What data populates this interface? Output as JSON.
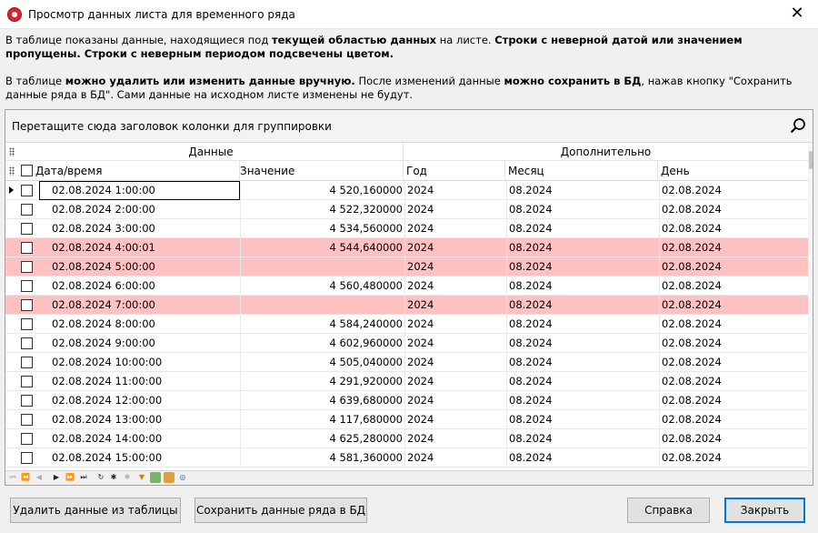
{
  "window": {
    "title": "Просмотр данных листа для временного ряда"
  },
  "info1": {
    "p1": "В таблице показаны данные, находящиеся под ",
    "b1": "текущей областью данных",
    "p2": " на листе.  ",
    "b2": "Строки с неверной датой или значением пропущены. Строки с неверным периодом подсвечены цветом."
  },
  "info2": {
    "p1": "В таблице ",
    "b1": "можно удалить или изменить данные вручную.",
    "p2": " После изменений данные ",
    "b2": "можно сохранить в БД",
    "p3": ", нажав кнопку \"Сохранить данные ряда в БД\". Сами данные на исходном листе изменены не будут."
  },
  "grid": {
    "group_panel_text": "Перетащите сюда заголовок колонки для группировки",
    "bands": {
      "data": "Данные",
      "extra": "Дополнительно"
    },
    "columns": {
      "datetime": "Дата/время",
      "value": "Значение",
      "year": "Год",
      "month": "Месяц",
      "day": "День"
    },
    "rows": [
      {
        "datetime": "02.08.2024 1:00:00",
        "value": "4 520,160000",
        "year": "2024",
        "month": "08.2024",
        "day": "02.08.2024",
        "highlight": false,
        "current": true
      },
      {
        "datetime": "02.08.2024 2:00:00",
        "value": "4 522,320000",
        "year": "2024",
        "month": "08.2024",
        "day": "02.08.2024",
        "highlight": false
      },
      {
        "datetime": "02.08.2024 3:00:00",
        "value": "4 534,560000",
        "year": "2024",
        "month": "08.2024",
        "day": "02.08.2024",
        "highlight": false
      },
      {
        "datetime": "02.08.2024 4:00:01",
        "value": "4 544,640000",
        "year": "2024",
        "month": "08.2024",
        "day": "02.08.2024",
        "highlight": true
      },
      {
        "datetime": "02.08.2024 5:00:00",
        "value": "",
        "year": "2024",
        "month": "08.2024",
        "day": "02.08.2024",
        "highlight": true
      },
      {
        "datetime": "02.08.2024 6:00:00",
        "value": "4 560,480000",
        "year": "2024",
        "month": "08.2024",
        "day": "02.08.2024",
        "highlight": false
      },
      {
        "datetime": "02.08.2024 7:00:00",
        "value": "",
        "year": "2024",
        "month": "08.2024",
        "day": "02.08.2024",
        "highlight": true
      },
      {
        "datetime": "02.08.2024 8:00:00",
        "value": "4 584,240000",
        "year": "2024",
        "month": "08.2024",
        "day": "02.08.2024",
        "highlight": false
      },
      {
        "datetime": "02.08.2024 9:00:00",
        "value": "4 602,960000",
        "year": "2024",
        "month": "08.2024",
        "day": "02.08.2024",
        "highlight": false
      },
      {
        "datetime": "02.08.2024 10:00:00",
        "value": "4 505,040000",
        "year": "2024",
        "month": "08.2024",
        "day": "02.08.2024",
        "highlight": false
      },
      {
        "datetime": "02.08.2024 11:00:00",
        "value": "4 291,920000",
        "year": "2024",
        "month": "08.2024",
        "day": "02.08.2024",
        "highlight": false
      },
      {
        "datetime": "02.08.2024 12:00:00",
        "value": "4 639,680000",
        "year": "2024",
        "month": "08.2024",
        "day": "02.08.2024",
        "highlight": false
      },
      {
        "datetime": "02.08.2024 13:00:00",
        "value": "4 117,680000",
        "year": "2024",
        "month": "08.2024",
        "day": "02.08.2024",
        "highlight": false
      },
      {
        "datetime": "02.08.2024 14:00:00",
        "value": "4 625,280000",
        "year": "2024",
        "month": "08.2024",
        "day": "02.08.2024",
        "highlight": false
      },
      {
        "datetime": "02.08.2024 15:00:00",
        "value": "4 581,360000",
        "year": "2024",
        "month": "08.2024",
        "day": "02.08.2024",
        "highlight": false
      }
    ],
    "highlight_color": "#ffc1c1"
  },
  "buttons": {
    "delete": "Удалить данные из таблицы",
    "save": "Сохранить данные ряда в БД",
    "help": "Справка",
    "close": "Закрыть"
  },
  "colors": {
    "default_button_border": "#0078d7",
    "app_icon": "#d9262e"
  }
}
